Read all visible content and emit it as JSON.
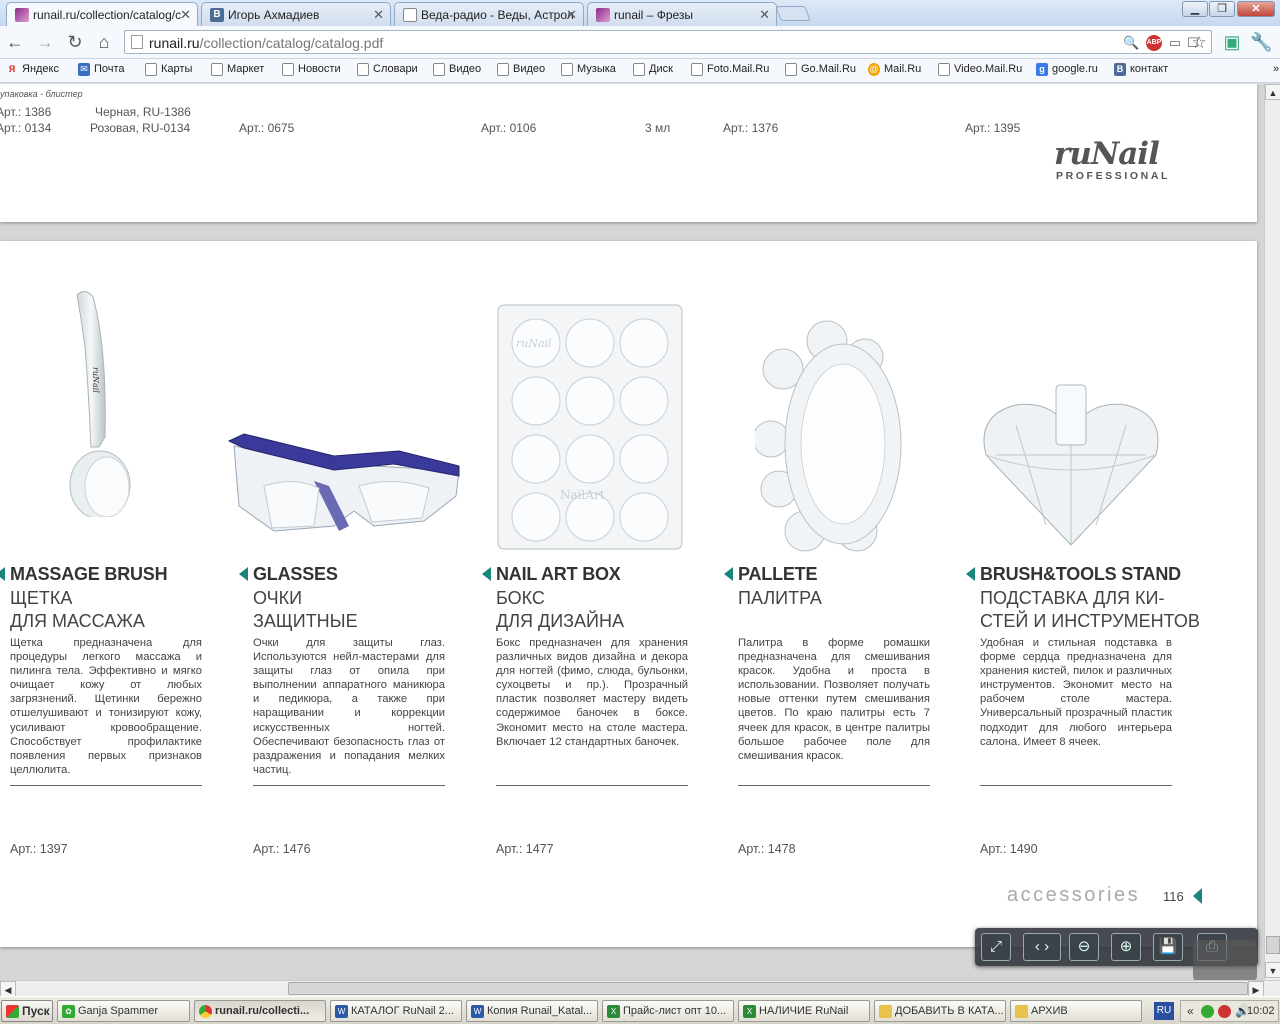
{
  "tabs": [
    {
      "label": "runail.ru/collection/catalog/c",
      "icon": "runail-favicon",
      "active": true
    },
    {
      "label": "Игорь Ахмадиев",
      "icon": "vk-favicon"
    },
    {
      "label": "Веда-радио - Веды, Астрол",
      "icon": "page-favicon"
    },
    {
      "label": "runail – Фрезы",
      "icon": "runail-favicon"
    }
  ],
  "address": {
    "host": "runail.ru",
    "path": "/collection/catalog/catalog.pdf"
  },
  "bookmarks": [
    {
      "label": "Яндекс",
      "icon": "yandex-icon"
    },
    {
      "label": "Почта",
      "icon": "mail-icon"
    },
    {
      "label": "Карты",
      "icon": "page-icon"
    },
    {
      "label": "Маркет",
      "icon": "page-icon"
    },
    {
      "label": "Новости",
      "icon": "page-icon"
    },
    {
      "label": "Словари",
      "icon": "page-icon"
    },
    {
      "label": "Видео",
      "icon": "page-icon"
    },
    {
      "label": "Видео",
      "icon": "page-icon"
    },
    {
      "label": "Музыка",
      "icon": "page-icon"
    },
    {
      "label": "Диск",
      "icon": "page-icon"
    },
    {
      "label": "Foto.Mail.Ru",
      "icon": "page-icon"
    },
    {
      "label": "Go.Mail.Ru",
      "icon": "page-icon"
    },
    {
      "label": "Mail.Ru",
      "icon": "mailru-icon"
    },
    {
      "label": "Video.Mail.Ru",
      "icon": "page-icon"
    },
    {
      "label": "google.ru",
      "icon": "google-icon"
    },
    {
      "label": "контакт",
      "icon": "vk-icon"
    }
  ],
  "page1": {
    "note": "упаковка - блистер",
    "row1": [
      "Арт.: 1386",
      "Черная, RU-1386"
    ],
    "row2": [
      "Арт.: 0134",
      "Розовая, RU-0134",
      "Арт.: 0675",
      "Арт.: 0106",
      "3 мл",
      "Арт.: 1376",
      "Арт.: 1395"
    ],
    "logo": "ruNail",
    "logo_sub": "PROFESSIONAL"
  },
  "products": [
    {
      "title": "MASSAGE BRUSH",
      "sub1": "ЩЕТКА",
      "sub2": "ДЛЯ МАССАЖА",
      "desc": "Щетка предназначена для процедуры легкого массажа и пилинга тела. Эффективно и мягко очищает кожу от любых загрязнений. Щетинки бережно отшелушивают и тонизируют кожу, усиливают кровообращение. Способствует профилактике появления первых признаков целлюлита.",
      "art": "Арт.: 1397"
    },
    {
      "title": "GLASSES",
      "sub1": "ОЧКИ",
      "sub2": "ЗАЩИТНЫЕ",
      "desc": "Очки для защиты глаз. Используются нейл-мастерами для защиты глаз от опила при выполнении аппаратного маникюра и педикюра, а также при наращивании и коррекции искусственных ногтей. Обеспечивают безопасность глаз от раздражения и попадания мелких частиц.",
      "art": "Арт.: 1476"
    },
    {
      "title": "NAIL ART BOX",
      "sub1": "БОКС",
      "sub2": "ДЛЯ ДИЗАЙНА",
      "desc": "Бокс предназначен для хранения различных видов дизайна и декора для ногтей (фимо, слюда, бульонки, сухоцветы и пр.). Прозрачный пластик позволяет мастеру видеть содержимое баночек в боксе. Экономит место на столе мастера. Включает 12 стандартных баночек.",
      "art": "Арт.: 1477"
    },
    {
      "title": "PALLETE",
      "sub1": "ПАЛИТРА",
      "sub2": "",
      "desc": "Палитра в форме ромашки предназначена для смешивания красок. Удобна и проста в использовании. Позволяет получать новые оттенки путем смешивания цветов. По краю палитры есть 7 ячеек для красок, в центре палитры большое рабочее поле для смешивания красок.",
      "art": "Арт.: 1478"
    },
    {
      "title": "BRUSH&TOOLS STAND",
      "sub1": "ПОДСТАВКА ДЛЯ КИ-",
      "sub2": "СТЕЙ И ИНСТРУМЕНТОВ",
      "desc": "Удобная и стильная подставка в форме сердца предназначена для хранения кистей, пилок и различных инструментов. Экономит место на рабочем столе мастера. Универсальный прозрачный пластик подходит для любого интерьера салона. Имеет 8 ячеек.",
      "art": "Арт.: 1490"
    }
  ],
  "footer": {
    "section": "accessories",
    "page": "116"
  },
  "taskbar": {
    "start": "Пуск",
    "tasks": [
      "Ganja Spammer",
      "runail.ru/collecti...",
      "КАТАЛОГ RuNail 2...",
      "Копия Runail_Katal...",
      "Прайс-лист опт 10...",
      "НАЛИЧИЕ RuNail",
      "ДОБАВИТЬ В КАТА...",
      "АРХИВ"
    ],
    "lang": "RU",
    "time": "10:02"
  }
}
